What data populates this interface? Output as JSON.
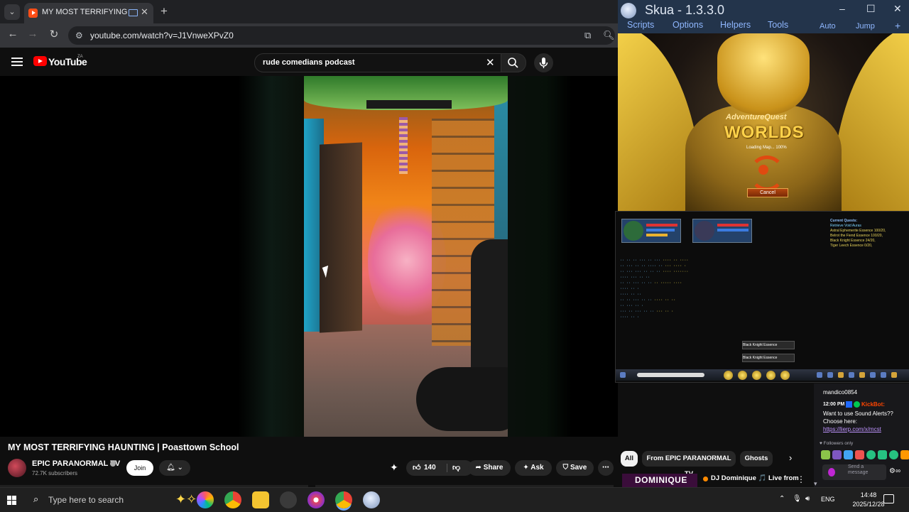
{
  "browser": {
    "tab_title": "MY MOST TERRIFYING HAUNTING | Poasttown School",
    "url": "youtube.com/watch?v=J1VnweXPvZ0"
  },
  "youtube": {
    "logo_text": "YouTube",
    "country_code": "ZA",
    "search_value": "rude comedians podcast",
    "video_title": "MY MOST TERRIFYING HAUNTING | Poasttown School",
    "channel_name": "EPIC PARANORMAL TV",
    "subscribers": "72.7K subscribers",
    "join_label": "Join",
    "like_count": "140",
    "share_label": "Share",
    "ask_label": "Ask",
    "save_label": "Save",
    "more_label": "⋯",
    "chips": [
      "All",
      "From EPIC PARANORMAL TV",
      "Ghosts"
    ],
    "rec_thumb_text": "DOMINIQUE",
    "rec_title": "DJ Dominique 🎵 Live from Japan | Pure Vibes Sunday"
  },
  "skua": {
    "title": "Skua - 1.3.3.0",
    "menu": [
      "Scripts",
      "Options",
      "Helpers",
      "Tools",
      "Auto",
      "Jump",
      "+"
    ],
    "game": {
      "logo_line1": "AdventureQuest",
      "logo_line2": "WORLDS",
      "loading_text": "Loading Map... 100%",
      "cancel_label": "Cancel"
    },
    "quests_title": "Current Quests:",
    "quests": [
      "Retrieve Void Auras",
      "Astral Ephemerite Essence 100/20,",
      "Belrot the Fiend Essence 100/20,",
      "Black Knight Essence 24/20,",
      "Tiger Leech Essence 0/20,"
    ],
    "drop_items": [
      "Black Knight Essence",
      "Black Knight Essence"
    ]
  },
  "chat": {
    "username": "mandico0854",
    "time": "12:00 PM",
    "bot_name": "KickBot:",
    "message": "Want to use Sound Alerts?? Choose here:",
    "link": "https://lierp.com/x/mcst",
    "followers_only": "Followers only",
    "send_placeholder": "Send a message"
  },
  "taskbar": {
    "search_placeholder": "Type here to search",
    "lang": "ENG",
    "time": "14:48",
    "date": "2025/12/28"
  },
  "colors": {
    "yt_bg": "#0f0f0f",
    "yt_red": "#ff0000",
    "skua_title_bg": "#23344b",
    "skua_menu": "#8fb7ff",
    "twitch_link": "#bf94ff",
    "taskbar_bg": "#202020"
  }
}
